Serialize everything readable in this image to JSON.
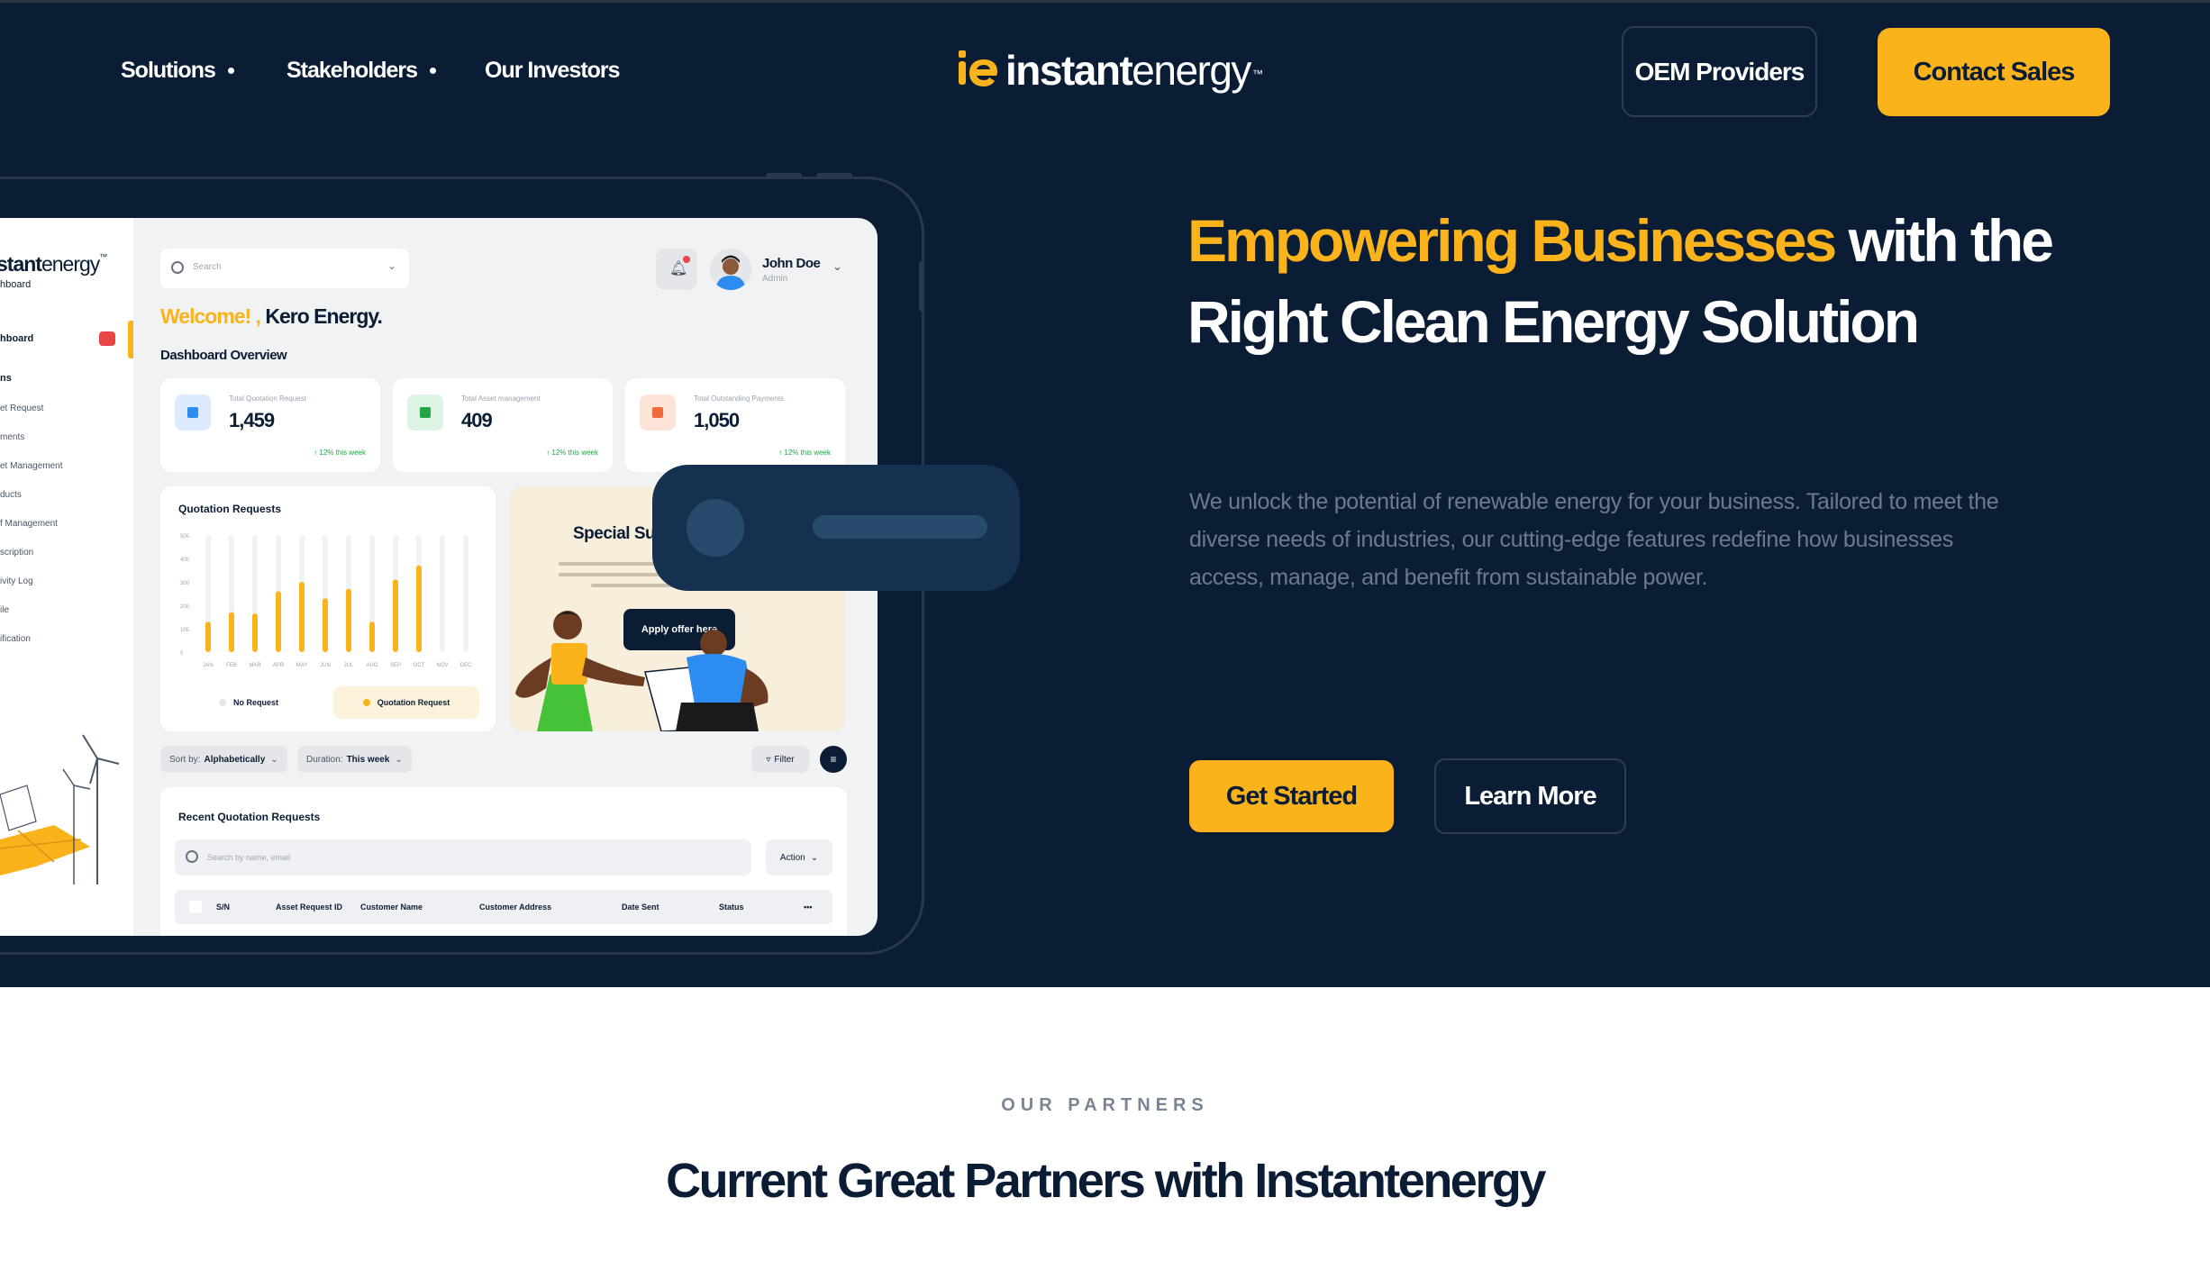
{
  "nav": {
    "links": [
      "Solutions",
      "Stakeholders",
      "Our Investors"
    ],
    "logo_bold": "instant",
    "logo_light": "energy",
    "logo_tm": "™",
    "oem_button": "OEM Providers",
    "contact_button": "Contact Sales"
  },
  "hero": {
    "headline_accent": "Empowering Businesses",
    "headline_rest": "with the Right Clean Energy Solution",
    "subtext": "We unlock the potential of renewable energy for your business. Tailored to meet the diverse needs of industries, our cutting-edge features redefine how businesses access, manage, and benefit from sustainable power.",
    "primary_button": "Get Started",
    "secondary_button": "Learn More"
  },
  "mockup": {
    "sidebar": {
      "logo_bold": "stant",
      "logo_light": "energy",
      "logo_tm": "™",
      "subtitle": "hboard",
      "dashboard_item": "hboard",
      "section": "ns",
      "items": [
        "et Request",
        "ments",
        "et Management",
        "ducts",
        "f Management",
        "scription",
        "ivity Log",
        "ile",
        "ification"
      ]
    },
    "search_placeholder": "Search",
    "user": {
      "name": "John Doe",
      "role": "Admin"
    },
    "welcome_accent": "Welcome! ,",
    "welcome_name": "Kero Energy.",
    "overview_title": "Dashboard Overview",
    "stats": [
      {
        "label": "Total Quotation Request",
        "value": "1,459",
        "trend": "↑  12% this week",
        "color": "#2d8cf0",
        "bg": "#dbeafe"
      },
      {
        "label": "Total Asset management",
        "value": "409",
        "trend": "↑  12% this week",
        "color": "#22a447",
        "bg": "#dcf5e3"
      },
      {
        "label": "Total Outstanding Payments",
        "value": "1,050",
        "trend": "↑  12% this week",
        "color": "#f06a3c",
        "bg": "#fde4d9"
      }
    ],
    "quotation_card": {
      "title": "Quotation Requests",
      "legend_no_request": "No Request",
      "legend_quotation": "Quotation Request"
    },
    "promo": {
      "title": "Special Su",
      "button": "Apply offer here"
    },
    "sort": {
      "label": "Sort by:",
      "value": "Alphabetically"
    },
    "duration": {
      "label": "Duration:",
      "value": "This week"
    },
    "filter_label": "Filter",
    "recent": {
      "title": "Recent Quotation Requests",
      "search_placeholder": "Search by name, email",
      "action_label": "Action",
      "columns": [
        "S/N",
        "Asset Request ID",
        "Customer Name",
        "Customer Address",
        "Date Sent",
        "Status",
        "•••"
      ]
    }
  },
  "chart_data": {
    "type": "bar",
    "title": "Quotation Requests",
    "categories": [
      "JAN",
      "FEB",
      "MAR",
      "APR",
      "MAY",
      "JUN",
      "JUL",
      "AUG",
      "SEP",
      "OCT",
      "NOV",
      "DEC"
    ],
    "y_ticks": [
      "500",
      "400",
      "300",
      "200",
      "100",
      "0"
    ],
    "ylim": [
      0,
      500
    ],
    "series": [
      {
        "name": "No Request",
        "values": [
          500,
          500,
          500,
          500,
          500,
          500,
          500,
          500,
          500,
          500,
          500,
          500
        ],
        "color": "#f1f2f4"
      },
      {
        "name": "Quotation Request",
        "values": [
          130,
          170,
          165,
          260,
          300,
          230,
          270,
          130,
          310,
          370,
          0,
          0
        ],
        "color": "#fbb31c"
      }
    ]
  },
  "partners": {
    "kicker": "OUR PARTNERS",
    "title": "Current Great Partners with Instantenergy"
  },
  "colors": {
    "navy": "#0b1d35",
    "accent": "#fbb31c",
    "subtext": "#6d7a8c"
  }
}
